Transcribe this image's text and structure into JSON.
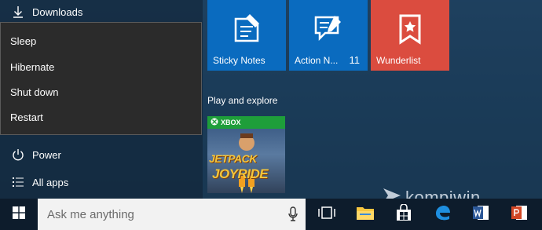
{
  "left_panel": {
    "downloads_label": "Downloads",
    "power_label": "Power",
    "all_apps_label": "All apps"
  },
  "power_menu": {
    "items": [
      {
        "label": "Sleep"
      },
      {
        "label": "Hibernate"
      },
      {
        "label": "Shut down"
      },
      {
        "label": "Restart"
      }
    ]
  },
  "tiles": [
    {
      "label": "Sticky Notes",
      "icon": "sticky-notes-icon",
      "color": "#0a6bbf"
    },
    {
      "label": "Action N...",
      "count": "11",
      "icon": "action-center-icon",
      "color": "#0a6bbf"
    },
    {
      "label": "Wunderlist",
      "icon": "wunderlist-icon",
      "color": "#db4c3f"
    }
  ],
  "play_section": {
    "title": "Play and explore",
    "xbox_label": "XBOX",
    "game_line1": "JETPACK",
    "game_line2": "JOYRIDE"
  },
  "watermark": {
    "text": "kompiwin"
  },
  "taskbar": {
    "search_placeholder": "Ask me anything",
    "icons": [
      "task-view-icon",
      "file-explorer-icon",
      "store-icon",
      "edge-icon",
      "word-icon",
      "powerpoint-icon"
    ]
  },
  "colors": {
    "tile_blue": "#0a6bbf",
    "tile_red": "#db4c3f",
    "xbox_green": "#1e9e3a",
    "flyout_bg": "#2b2b2b"
  }
}
